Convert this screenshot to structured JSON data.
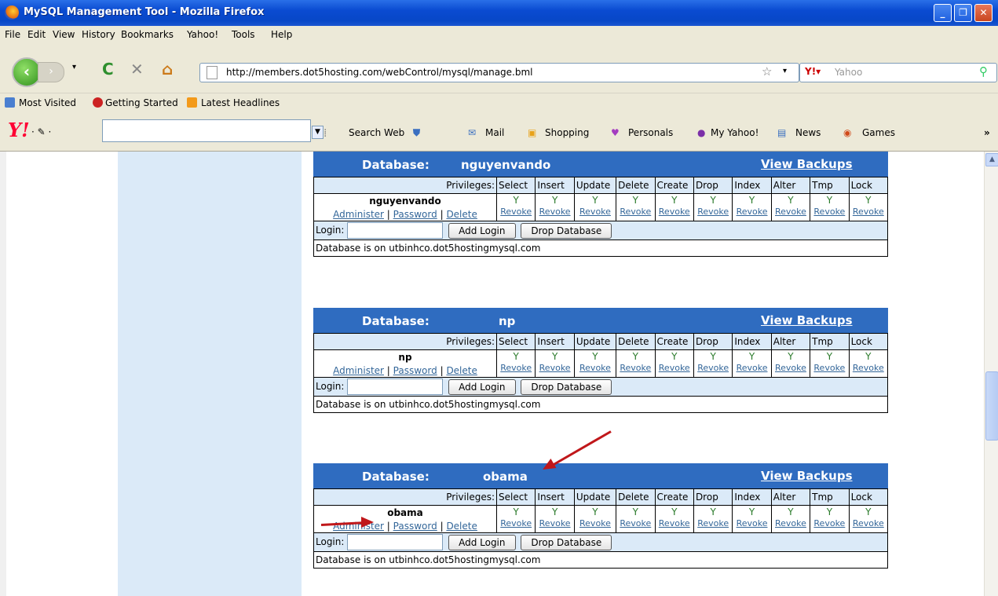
{
  "window": {
    "title": "MySQL Management Tool - Mozilla Firefox",
    "minimize_glyph": "_",
    "maximize_glyph": "❐",
    "close_glyph": "✕"
  },
  "menu": [
    "File",
    "Edit",
    "View",
    "History",
    "Bookmarks",
    "Yahoo!",
    "Tools",
    "Help"
  ],
  "navigation": {
    "url": "http://members.dot5hosting.com/webControl/mysql/manage.bml",
    "search_placeholder": "Yahoo"
  },
  "bookmarks": [
    "Most Visited",
    "Getting Started",
    "Latest Headlines"
  ],
  "yahoo_toolbar": {
    "logo": "Y!",
    "items": [
      "Search Web",
      "Mail",
      "Shopping",
      "Personals",
      "My Yahoo!",
      "News",
      "Games"
    ],
    "overflow": "»"
  },
  "privilege_headers": [
    "Privileges:",
    "Select",
    "Insert",
    "Update",
    "Delete",
    "Create",
    "Drop",
    "Index",
    "Alter",
    "Tmp",
    "Lock"
  ],
  "privilege_value": "Y",
  "revoke_label": "Revoke",
  "user_links": {
    "administer": "Administer",
    "password": "Password",
    "delete": "Delete",
    "sep": "|"
  },
  "login_label": "Login:",
  "add_login_label": "Add Login",
  "drop_database_label": "Drop Database",
  "db_label": "Database:",
  "view_backups_label": "View Backups",
  "databases": [
    {
      "name": "nguyenvando",
      "user": "nguyenvando",
      "host_info": "Database is on utbinhco.dot5hostingmysql.com"
    },
    {
      "name": "np",
      "user": "np",
      "host_info": "Database is on utbinhco.dot5hostingmysql.com"
    },
    {
      "name": "obama",
      "user": "obama",
      "host_info": "Database is on utbinhco.dot5hostingmysql.com"
    }
  ],
  "colors": {
    "accent": "#2f6cc0",
    "panel": "#dbeaf8",
    "arrow": "#c0171a"
  }
}
